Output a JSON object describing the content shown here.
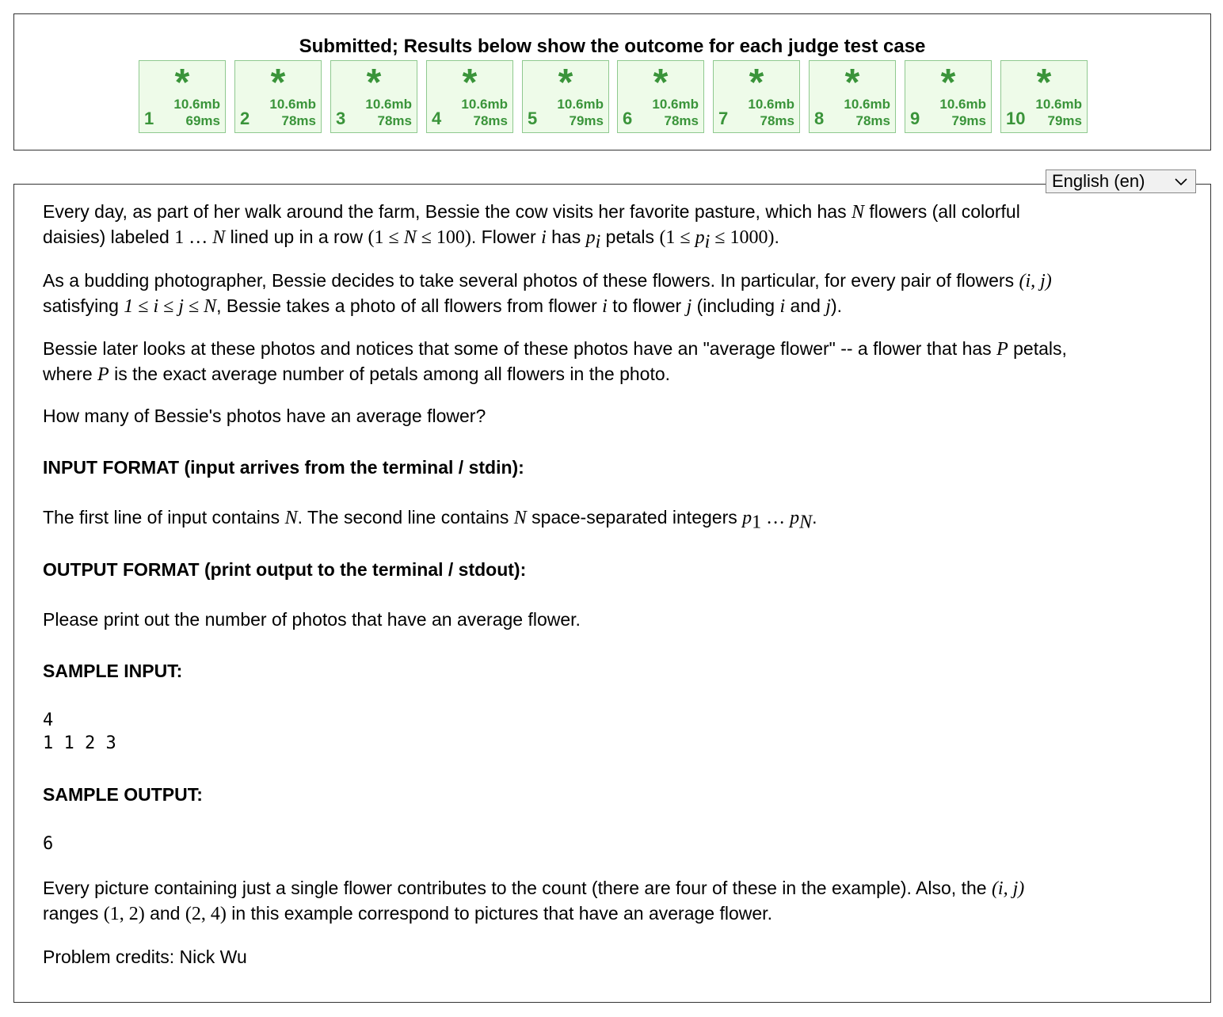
{
  "results": {
    "title": "Submitted; Results below show the outcome for each judge test case",
    "cases": [
      {
        "num": "1",
        "symbol": "*",
        "memory": "10.6mb",
        "time": "69ms"
      },
      {
        "num": "2",
        "symbol": "*",
        "memory": "10.6mb",
        "time": "78ms"
      },
      {
        "num": "3",
        "symbol": "*",
        "memory": "10.6mb",
        "time": "78ms"
      },
      {
        "num": "4",
        "symbol": "*",
        "memory": "10.6mb",
        "time": "78ms"
      },
      {
        "num": "5",
        "symbol": "*",
        "memory": "10.6mb",
        "time": "79ms"
      },
      {
        "num": "6",
        "symbol": "*",
        "memory": "10.6mb",
        "time": "78ms"
      },
      {
        "num": "7",
        "symbol": "*",
        "memory": "10.6mb",
        "time": "78ms"
      },
      {
        "num": "8",
        "symbol": "*",
        "memory": "10.6mb",
        "time": "78ms"
      },
      {
        "num": "9",
        "symbol": "*",
        "memory": "10.6mb",
        "time": "79ms"
      },
      {
        "num": "10",
        "symbol": "*",
        "memory": "10.6mb",
        "time": "79ms"
      }
    ],
    "pass_color": "#3a943a"
  },
  "language_select": {
    "value": "English (en)",
    "icon": "chevron-down-icon"
  },
  "problem": {
    "p1": {
      "a": "Every day, as part of her walk around the farm, Bessie the cow visits her favorite pasture, which has ",
      "N": "N",
      "b": " flowers (all colorful",
      "c": "daisies) labeled ",
      "range": "1 … ",
      "N2": "N",
      "d": " lined up in a row ",
      "cons1": "(1 ≤ ",
      "N3": "N",
      "cons1b": " ≤ 100)",
      "e": ". Flower ",
      "i": "i",
      "f": " has ",
      "p": "p",
      "pi": "i",
      "g": " petals ",
      "cons2a": "(1 ≤ ",
      "p2": "p",
      "pi2": "i",
      "cons2b": " ≤ 1000)",
      "h": "."
    },
    "p2": {
      "a": "As a budding photographer, Bessie decides to take several photos of these flowers. In particular, for every pair of flowers ",
      "pair": "(i, j)",
      "b": "satisfying ",
      "cond": "1 ≤ i ≤ j ≤ N",
      "c": ", Bessie takes a photo of all flowers from flower ",
      "i": "i",
      "d": " to flower ",
      "j": "j",
      "e": " (including ",
      "i2": "i",
      "f": " and ",
      "j2": "j",
      "g": ")."
    },
    "p3": {
      "a": "Bessie later looks at these photos and notices that some of these photos have an \"average flower\" -- a flower that has ",
      "P": "P",
      "b": " petals,",
      "c": "where ",
      "P2": "P",
      "d": " is the exact average number of petals among all flowers in the photo."
    },
    "p4": "How many of Bessie's photos have an average flower?",
    "input_heading": "INPUT FORMAT (input arrives from the terminal / stdin):",
    "input_text": {
      "a": "The first line of input contains ",
      "N": "N",
      "b": ". The second line contains ",
      "N2": "N",
      "c": " space-separated integers ",
      "p1": "p",
      "s1": "1",
      "dots": " … ",
      "pN": "p",
      "sN": "N",
      "d": "."
    },
    "output_heading": "OUTPUT FORMAT (print output to the terminal / stdout):",
    "output_text": "Please print out the number of photos that have an average flower.",
    "sample_input_heading": "SAMPLE INPUT:",
    "sample_input": "4\n1 1 2 3",
    "sample_output_heading": "SAMPLE OUTPUT:",
    "sample_output": "6",
    "explanation": {
      "a": "Every picture containing just a single flower contributes to the count (there are four of these in the example). Also, the ",
      "pair": "(i, j)",
      "b": "ranges ",
      "r1": "(1, 2)",
      "c": " and ",
      "r2": "(2, 4)",
      "d": " in this example correspond to pictures that have an average flower."
    },
    "credits": "Problem credits: Nick Wu"
  }
}
